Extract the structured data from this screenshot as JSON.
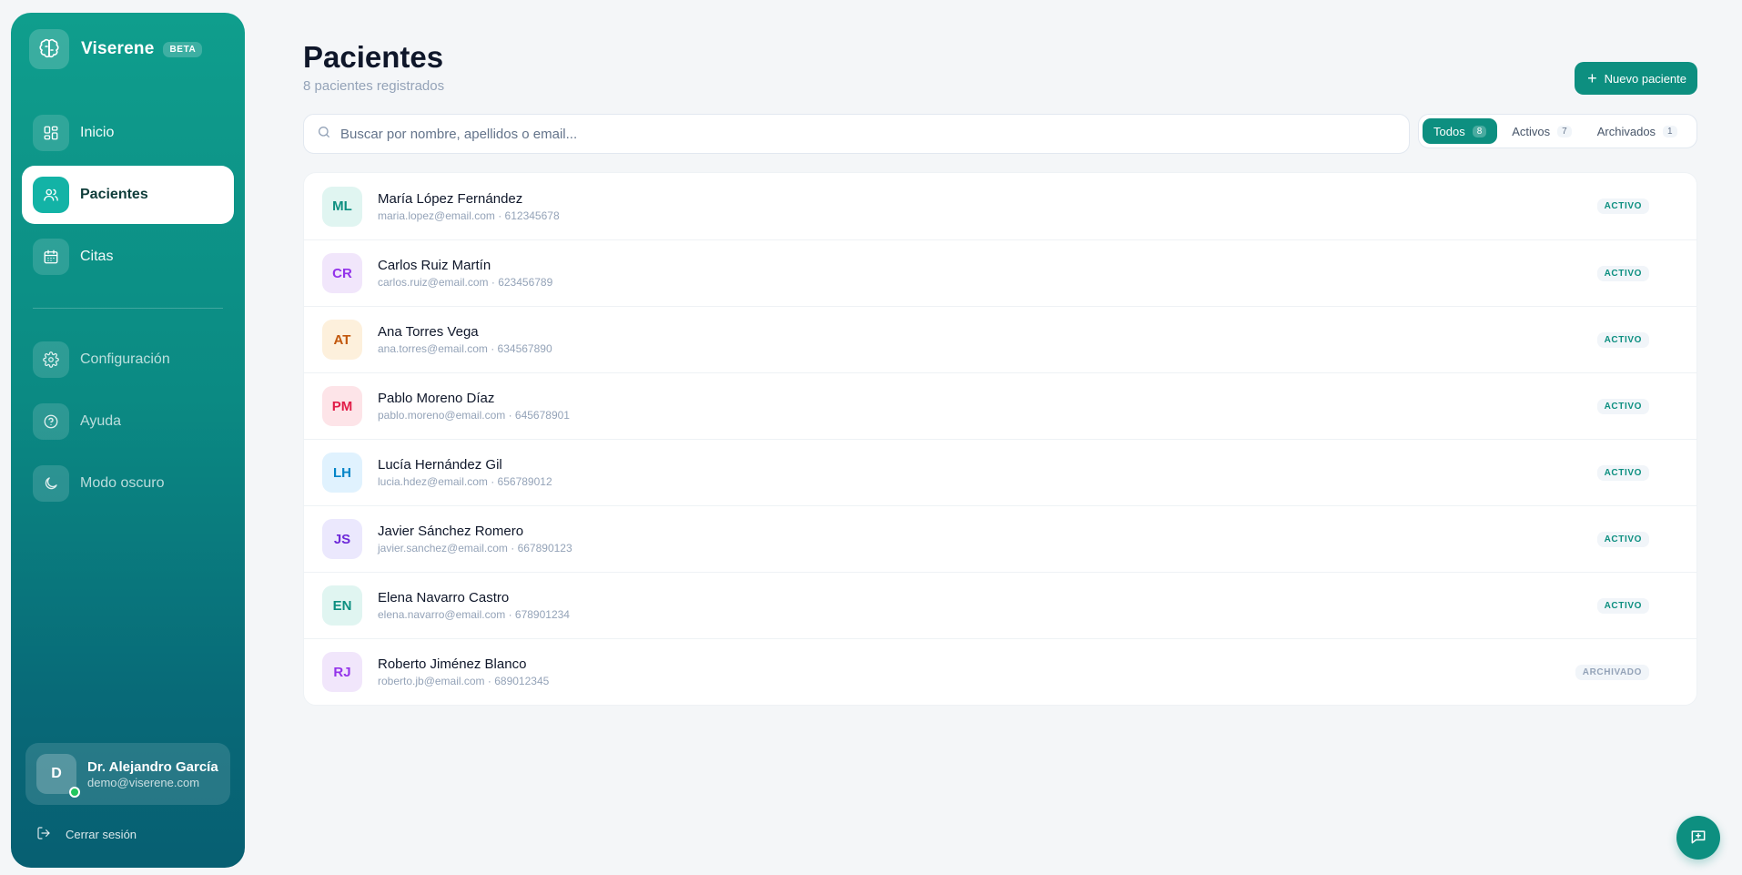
{
  "brand": {
    "name": "Viserene",
    "badge": "BETA"
  },
  "nav": {
    "items": [
      {
        "label": "Inicio",
        "icon": "grid-icon"
      },
      {
        "label": "Pacientes",
        "icon": "users-icon"
      },
      {
        "label": "Citas",
        "icon": "calendar-icon"
      }
    ],
    "secondary": [
      {
        "label": "Configuración",
        "icon": "gear-icon"
      },
      {
        "label": "Ayuda",
        "icon": "help-icon"
      },
      {
        "label": "Modo oscuro",
        "icon": "moon-icon"
      }
    ]
  },
  "user": {
    "initial": "D",
    "name": "Dr. Alejandro García",
    "email": "demo@viserene.com"
  },
  "logout_label": "Cerrar sesión",
  "header": {
    "title": "Pacientes",
    "subtitle": "8 pacientes registrados",
    "new_button": "Nuevo paciente"
  },
  "search": {
    "placeholder": "Buscar por nombre, apellidos o email..."
  },
  "filters": [
    {
      "label": "Todos",
      "count": "8"
    },
    {
      "label": "Activos",
      "count": "7"
    },
    {
      "label": "Archivados",
      "count": "1"
    }
  ],
  "patients": [
    {
      "initials": "ML",
      "name": "María López Fernández",
      "meta": "maria.lopez@email.com · 612345678",
      "status": "ACTIVO",
      "avatar_bg": "#e0f5f1",
      "avatar_fg": "#0d8f80"
    },
    {
      "initials": "CR",
      "name": "Carlos Ruiz Martín",
      "meta": "carlos.ruiz@email.com · 623456789",
      "status": "ACTIVO",
      "avatar_bg": "#f1e6fb",
      "avatar_fg": "#9333ea"
    },
    {
      "initials": "AT",
      "name": "Ana Torres Vega",
      "meta": "ana.torres@email.com · 634567890",
      "status": "ACTIVO",
      "avatar_bg": "#fdf0dc",
      "avatar_fg": "#c2570c"
    },
    {
      "initials": "PM",
      "name": "Pablo Moreno Díaz",
      "meta": "pablo.moreno@email.com · 645678901",
      "status": "ACTIVO",
      "avatar_bg": "#fde4e8",
      "avatar_fg": "#e11d48"
    },
    {
      "initials": "LH",
      "name": "Lucía Hernández Gil",
      "meta": "lucia.hdez@email.com · 656789012",
      "status": "ACTIVO",
      "avatar_bg": "#e0f2fe",
      "avatar_fg": "#0284c7"
    },
    {
      "initials": "JS",
      "name": "Javier Sánchez Romero",
      "meta": "javier.sanchez@email.com · 667890123",
      "status": "ACTIVO",
      "avatar_bg": "#ebe8fd",
      "avatar_fg": "#6d28d9"
    },
    {
      "initials": "EN",
      "name": "Elena Navarro Castro",
      "meta": "elena.navarro@email.com · 678901234",
      "status": "ACTIVO",
      "avatar_bg": "#e0f5f1",
      "avatar_fg": "#0d8f80"
    },
    {
      "initials": "RJ",
      "name": "Roberto Jiménez Blanco",
      "meta": "roberto.jb@email.com · 689012345",
      "status": "ARCHIVADO",
      "avatar_bg": "#f1e6fb",
      "avatar_fg": "#9333ea"
    }
  ]
}
